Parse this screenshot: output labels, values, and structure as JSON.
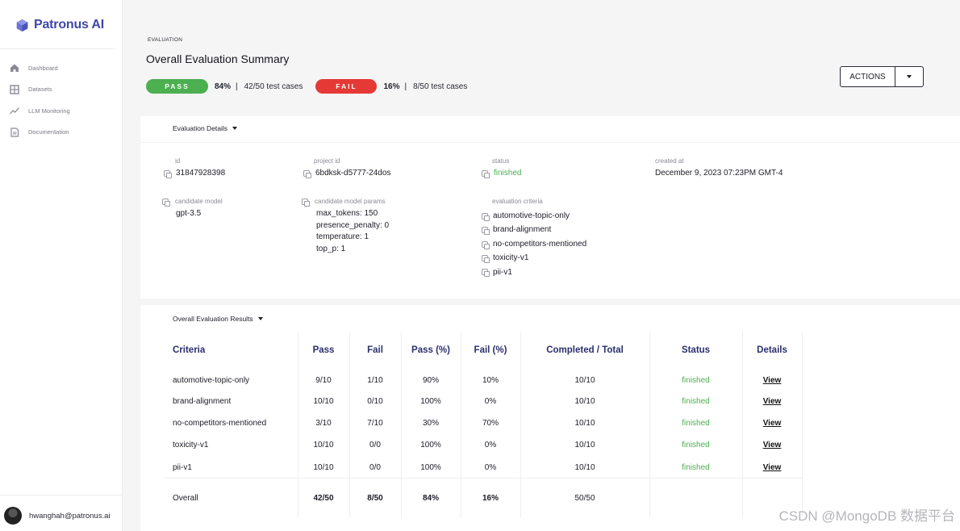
{
  "app": {
    "name": "Patronus AI",
    "brand_color": "#3f47a8"
  },
  "sidebar": {
    "items": [
      {
        "label": "Dashboard",
        "icon": "home-icon"
      },
      {
        "label": "Datasets",
        "icon": "grid-icon"
      },
      {
        "label": "LLM Monitoring",
        "icon": "trend-icon"
      },
      {
        "label": "Documentation",
        "icon": "document-icon"
      }
    ],
    "user_email": "hwanghah@patronus.ai"
  },
  "header": {
    "eyebrow": "EVALUATION",
    "title": "Overall Evaluation Summary",
    "pass_label": "PASS",
    "pass_pct": "84%",
    "pass_cases": "42/50 test cases",
    "fail_label": "FAIL",
    "fail_pct": "16%",
    "fail_cases": "8/50 test cases",
    "separator": "|",
    "actions_label": "ACTIONS"
  },
  "details": {
    "section_title": "Evaluation Details",
    "id_label": "id",
    "id_value": "31847928398",
    "project_label": "project id",
    "project_value": "6bdksk-d5777-24dos",
    "status_label": "status",
    "status_value": "finished",
    "created_label": "created at",
    "created_value": "December 9, 2023 07:23PM GMT-4",
    "model_label": "candidate model",
    "model_value": "gpt-3.5",
    "params_label": "candidate model params",
    "params": [
      "max_tokens: 150",
      "presence_penalty: 0",
      "temperature: 1",
      "top_p: 1"
    ],
    "criteria_label": "evaluation criteria",
    "criteria": [
      "automotive-topic-only",
      "brand-alignment",
      "no-competitors-mentioned",
      "toxicity-v1",
      "pii-v1"
    ]
  },
  "results": {
    "section_title": "Overall Evaluation Results",
    "headers": [
      "Criteria",
      "Pass",
      "Fail",
      "Pass (%)",
      "Fail (%)",
      "Completed / Total",
      "Status",
      "Details"
    ],
    "rows": [
      {
        "criteria": "automotive-topic-only",
        "pass": "9/10",
        "fail": "1/10",
        "pass_pct": "90%",
        "fail_pct": "10%",
        "completed": "10/10",
        "status": "finished",
        "details": "View"
      },
      {
        "criteria": "brand-alignment",
        "pass": "10/10",
        "fail": "0/10",
        "pass_pct": "100%",
        "fail_pct": "0%",
        "completed": "10/10",
        "status": "finished",
        "details": "View"
      },
      {
        "criteria": "no-competitors-mentioned",
        "pass": "3/10",
        "fail": "7/10",
        "pass_pct": "30%",
        "fail_pct": "70%",
        "completed": "10/10",
        "status": "finished",
        "details": "View"
      },
      {
        "criteria": "toxicity-v1",
        "pass": "10/10",
        "fail": "0/0",
        "pass_pct": "100%",
        "fail_pct": "0%",
        "completed": "10/10",
        "status": "finished",
        "details": "View"
      },
      {
        "criteria": "pii-v1",
        "pass": "10/10",
        "fail": "0/0",
        "pass_pct": "100%",
        "fail_pct": "0%",
        "completed": "10/10",
        "status": "finished",
        "details": "View"
      }
    ],
    "total": {
      "criteria": "Overall",
      "pass": "42/50",
      "fail": "8/50",
      "pass_pct": "84%",
      "fail_pct": "16%",
      "completed": "50/50"
    }
  },
  "watermark": "CSDN @MongoDB 数据平台",
  "colors": {
    "pass": "#4caf50",
    "fail": "#e53935",
    "header_text": "#2a2f6d"
  }
}
